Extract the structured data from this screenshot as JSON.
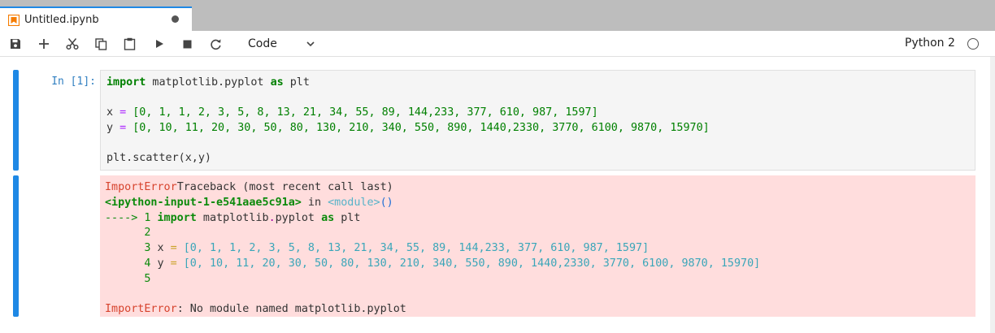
{
  "tab": {
    "title": "Untitled.ipynb"
  },
  "toolbar": {
    "cell_type": "Code",
    "kernel": "Python 2",
    "buttons": [
      {
        "name": "save-button",
        "icon": "save-icon"
      },
      {
        "name": "insert-cell-button",
        "icon": "plus-icon"
      },
      {
        "name": "cut-button",
        "icon": "scissors-icon"
      },
      {
        "name": "copy-button",
        "icon": "copy-icon"
      },
      {
        "name": "paste-button",
        "icon": "paste-icon"
      },
      {
        "name": "run-button",
        "icon": "play-icon"
      },
      {
        "name": "interrupt-button",
        "icon": "stop-icon"
      },
      {
        "name": "restart-button",
        "icon": "restart-icon"
      }
    ]
  },
  "cell": {
    "prompt": "In [1]:",
    "code": {
      "line1_kw1": "import",
      "line1_mod": " matplotlib.pyplot ",
      "line1_kw2": "as",
      "line1_alias": " plt",
      "line3_prefix": "x ",
      "line3_eq": "=",
      "line3_values": " [0, 1, 1, 2, 3, 5, 8, 13, 21, 34, 55, 89, 144,233, 377, 610, 987, 1597]",
      "line4_prefix": "y ",
      "line4_eq": "=",
      "line4_values": " [0, 10, 11, 20, 30, 50, 80, 130, 210, 340, 550, 890, 1440,2330, 3770, 6100, 9870, 15970]",
      "line6": "plt.scatter(x,y)"
    },
    "output": {
      "error_name": "ImportError",
      "traceback_header": "Traceback (most recent call last)",
      "input_ref": "<ipython-input-1-e541aae5c91a>",
      "in_word": " in ",
      "module_ref": "<module>",
      "module_parens": "()",
      "arrow_line_arrow": "----> 1 ",
      "arrow_line_kw": "import",
      "arrow_line_mod": " matplotlib",
      "arrow_line_dot": ".",
      "arrow_line_rest": "pyplot ",
      "arrow_line_as": "as",
      "arrow_line_alias": " plt",
      "ln2": "      2",
      "ln3_no": "      3 ",
      "ln3_var": "x ",
      "ln3_eq": "=",
      "ln3_values": " [0, 1, 1, 2, 3, 5, 8, 13, 21, 34, 55, 89, 144,233, 377, 610, 987, 1597]",
      "ln4_no": "      4 ",
      "ln4_var": "y ",
      "ln4_eq": "=",
      "ln4_values": " [0, 10, 11, 20, 30, 50, 80, 130, 210, 340, 550, 890, 1440,2330, 3770, 6100, 9870, 15970]",
      "ln5": "      5",
      "final_error_name": "ImportError",
      "final_message": ": No module named matplotlib.pyplot"
    }
  },
  "colors": {
    "accent": "#1e88e5",
    "error_background": "#ffdddd",
    "error_text": "#d7442e"
  }
}
